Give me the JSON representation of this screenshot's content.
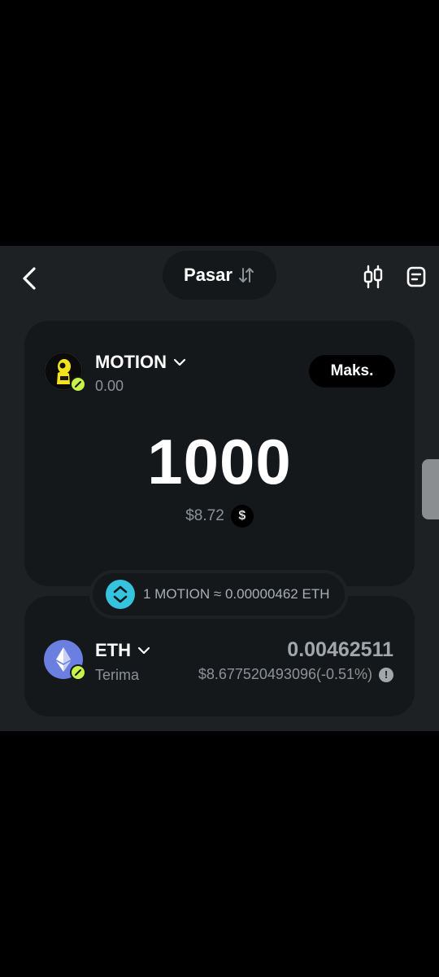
{
  "header": {
    "title": "Pasar"
  },
  "from_token": {
    "symbol": "MOTION",
    "balance": "0.00",
    "max_label": "Maks.",
    "amount": "1000",
    "usd_value": "$8.72"
  },
  "rate": {
    "text": "1 MOTION ≈ 0.00000462 ETH"
  },
  "to_token": {
    "symbol": "ETH",
    "label": "Terima",
    "amount": "0.00462511",
    "usd_value": "$8.677520493096(-0.51%)"
  },
  "colors": {
    "background": "#1e2124",
    "card": "#15181b",
    "accent": "#35c3de",
    "badge": "#c6f24a",
    "eth": "#6b7fe0"
  }
}
